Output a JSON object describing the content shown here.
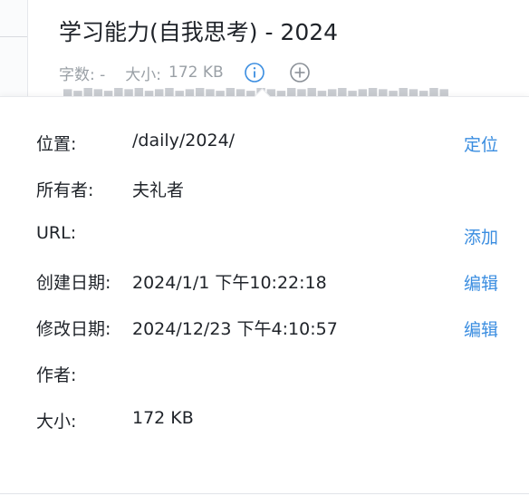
{
  "header": {
    "title": "学习能力(自我思考) - 2024",
    "word_count_label": "字数: -",
    "size_label": "大小:",
    "size_value": "172 KB",
    "info_icon": "info-circle-icon",
    "add_icon": "plus-circle-icon"
  },
  "properties": {
    "location": {
      "label": "位置:",
      "value": "/daily/2024/",
      "action": "定位"
    },
    "owner": {
      "label": "所有者:",
      "value": "夫礼者"
    },
    "url": {
      "label": "URL:",
      "value": "",
      "action": "添加"
    },
    "created": {
      "label": "创建日期:",
      "value": "2024/1/1 下午10:22:18",
      "action": "编辑"
    },
    "modified": {
      "label": "修改日期:",
      "value": "2024/12/23 下午4:10:57",
      "action": "编辑"
    },
    "author": {
      "label": "作者:",
      "value": ""
    },
    "size": {
      "label": "大小:",
      "value": "172 KB"
    }
  },
  "colors": {
    "accent": "#3a8de0",
    "text": "#1f2329",
    "muted": "#9aa0a6"
  }
}
